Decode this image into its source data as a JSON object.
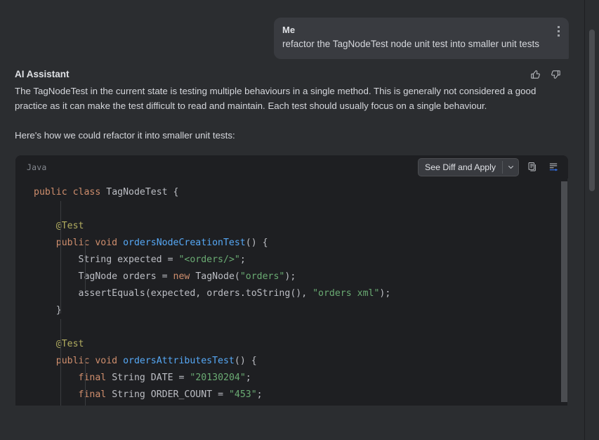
{
  "theme": {
    "background": "#2b2d30",
    "bubble_bg": "#393b40",
    "code_bg": "#1e1f22",
    "text": "#d5d7dc",
    "accent_blue": "#56a8f5",
    "keyword_orange": "#cf8e6d",
    "string_green": "#6aab73",
    "annotation_olive": "#b3ae60"
  },
  "user_message": {
    "author": "Me",
    "text": "refactor the TagNodeTest node unit test into smaller unit tests",
    "menu_icon": "kebab-menu-icon"
  },
  "assistant_message": {
    "author": "AI Assistant",
    "paragraph_1": "The TagNodeTest in the current state is testing multiple behaviours in a single method. This is generally not considered a good practice as it can make the test difficult to read and maintain. Each test should usually focus on a single behaviour.",
    "paragraph_2": "Here's how we could refactor it into smaller unit tests:",
    "thumbs_up_icon": "thumbs-up-icon",
    "thumbs_down_icon": "thumbs-down-icon"
  },
  "code_block": {
    "language": "Java",
    "apply_button_label": "See Diff and Apply",
    "dropdown_icon": "chevron-down-icon",
    "copy_icon": "copy-icon",
    "insert_icon": "insert-into-editor-icon",
    "code": "public class TagNodeTest {\n\n    @Test\n    public void ordersNodeCreationTest() {\n        String expected = \"<orders/>\";\n        TagNode orders = new TagNode(\"orders\");\n        assertEquals(expected, orders.toString(), \"orders xml\");\n    }\n\n    @Test\n    public void ordersAttributesTest() {\n        final String DATE = \"20130204\";\n        final String ORDER_COUNT = \"453\";"
  },
  "scrollbars": {
    "main_scrollbar": "main-vertical-scrollbar",
    "code_scrollbar": "code-vertical-scrollbar"
  }
}
